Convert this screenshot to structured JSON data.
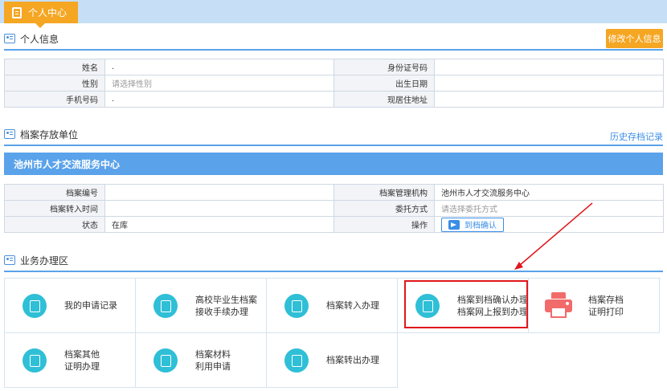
{
  "tab": {
    "label": "个人中心"
  },
  "personal_info": {
    "title": "个人信息",
    "edit_button": "修改个人信息",
    "rows": [
      {
        "l1": "姓名",
        "v1": ".",
        "l2": "身份证号码",
        "v2": ""
      },
      {
        "l1": "性别",
        "v1": "请选择性别",
        "l2": "出生日期",
        "v2": ""
      },
      {
        "l1": "手机号码",
        "v1": ".",
        "l2": "现居住地址",
        "v2": ""
      }
    ]
  },
  "archive_unit": {
    "title": "档案存放单位",
    "history_link": "历史存档记录",
    "banner": "池州市人才交流服务中心",
    "rows": [
      {
        "l1": "档案编号",
        "v1": "",
        "l2": "档案管理机构",
        "v2": "池州市人才交流服务中心"
      },
      {
        "l1": "档案转入时间",
        "v1": "",
        "l2": "委托方式",
        "v2": "请选择委托方式"
      },
      {
        "l1": "状态",
        "v1": "在库",
        "l2": "操作",
        "v2": ""
      }
    ],
    "confirm_button": "到档确认"
  },
  "business": {
    "title": "业务办理区",
    "items": [
      {
        "line1": "我的申请记录",
        "line2": ""
      },
      {
        "line1": "高校毕业生档案",
        "line2": "接收手续办理"
      },
      {
        "line1": "档案转入办理",
        "line2": ""
      },
      {
        "line1": "档案到档确认办理",
        "line2": "档案网上报到办理"
      },
      {
        "line1": "档案存档",
        "line2": "证明打印"
      },
      {
        "line1": "档案其他",
        "line2": "证明办理"
      },
      {
        "line1": "档案材料",
        "line2": "利用申请"
      },
      {
        "line1": "档案转出办理",
        "line2": ""
      }
    ]
  },
  "colors": {
    "accent": "#f5a623",
    "primary": "#5aa2ea",
    "teal": "#2fbfd6",
    "highlight": "#e0171b"
  }
}
